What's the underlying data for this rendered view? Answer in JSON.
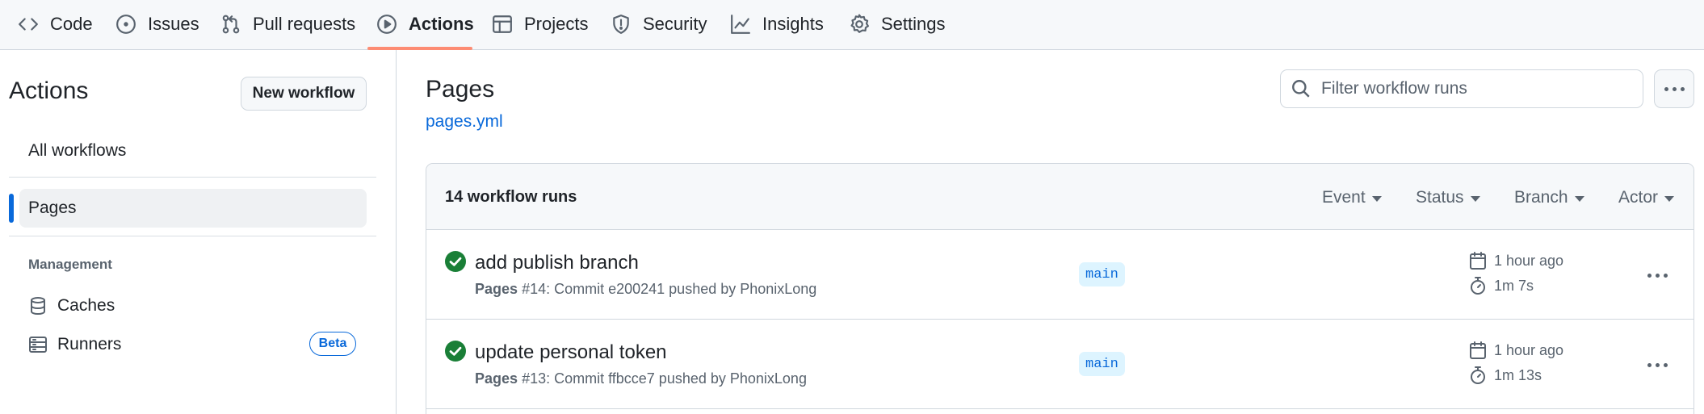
{
  "nav": {
    "tabs": [
      {
        "label": "Code",
        "icon": "code-icon"
      },
      {
        "label": "Issues",
        "icon": "issue-opened-icon"
      },
      {
        "label": "Pull requests",
        "icon": "git-pull-request-icon"
      },
      {
        "label": "Actions",
        "icon": "play-icon",
        "selected": true
      },
      {
        "label": "Projects",
        "icon": "table-icon"
      },
      {
        "label": "Security",
        "icon": "shield-icon"
      },
      {
        "label": "Insights",
        "icon": "graph-icon"
      },
      {
        "label": "Settings",
        "icon": "gear-icon"
      }
    ],
    "selected_underline_color": "#fd8c73"
  },
  "sidebar": {
    "title": "Actions",
    "new_workflow_label": "New workflow",
    "items": [
      {
        "label": "All workflows"
      },
      {
        "label": "Pages",
        "active": true
      }
    ],
    "management_heading": "Management",
    "management_items": [
      {
        "label": "Caches",
        "icon": "database-icon"
      },
      {
        "label": "Runners",
        "icon": "server-icon",
        "badge": "Beta"
      }
    ]
  },
  "main": {
    "title": "Pages",
    "workflow_file": "pages.yml",
    "search_placeholder": "Filter workflow runs",
    "runs_count_label": "14 workflow runs",
    "filters": [
      "Event",
      "Status",
      "Branch",
      "Actor"
    ],
    "runs": [
      {
        "title": "add publish branch",
        "workflow": "Pages",
        "detail": "#14: Commit e200241 pushed by PhonixLong",
        "branch": "main",
        "time_ago": "1 hour ago",
        "duration": "1m 7s",
        "status": "success"
      },
      {
        "title": "update personal token",
        "workflow": "Pages",
        "detail": "#13: Commit ffbcce7 pushed by PhonixLong",
        "branch": "main",
        "time_ago": "1 hour ago",
        "duration": "1m 13s",
        "status": "success"
      }
    ]
  },
  "colors": {
    "accent": "#0969da",
    "success": "#1a7f37",
    "branch_bg": "#ddf4ff"
  }
}
